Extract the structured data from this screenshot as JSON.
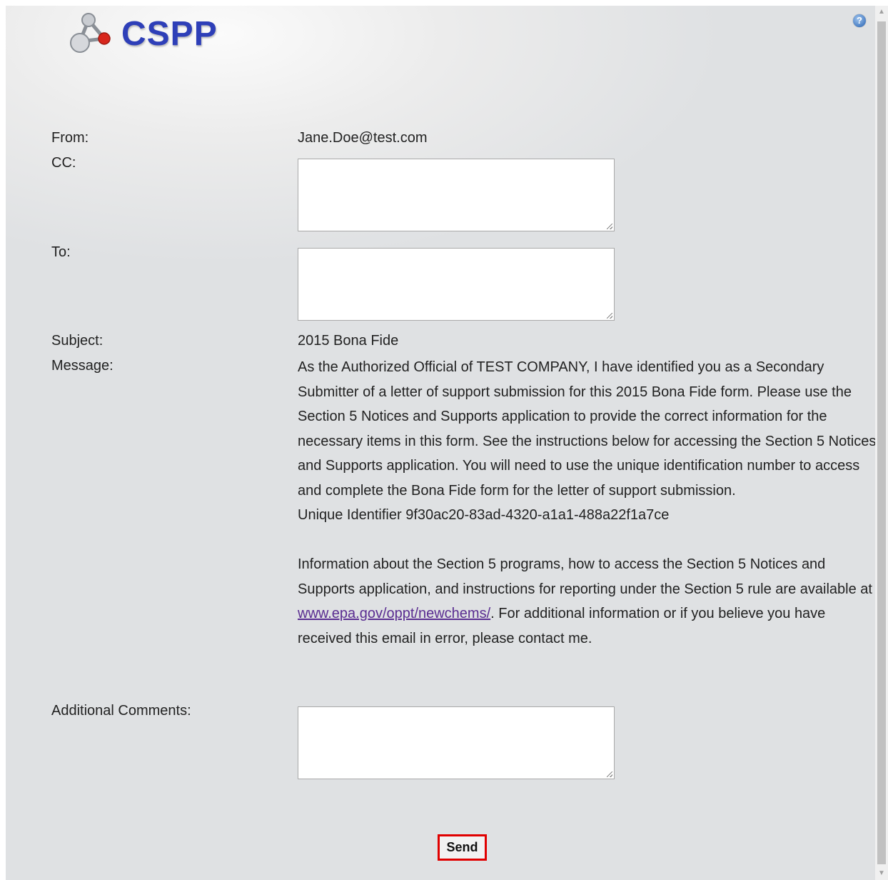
{
  "header": {
    "logo_text": "CSPP",
    "help_icon": "?"
  },
  "form": {
    "from_label": "From:",
    "from_value": "Jane.Doe@test.com",
    "cc_label": "CC:",
    "cc_value": "",
    "to_label": "To:",
    "to_value": "",
    "subject_label": "Subject:",
    "subject_value": "2015 Bona Fide",
    "message_label": "Message:",
    "message_para1": "As the Authorized Official of TEST COMPANY, I have identified you as a Secondary Submitter of a letter of support submission for this 2015 Bona Fide form. Please use the Section 5 Notices and Supports application to provide the correct information for the necessary items in this form. See the instructions below for accessing the Section 5 Notices and Supports application. You will need to use the unique identification number to access and complete the Bona Fide form for the letter of support submission.",
    "message_identifier": "Unique Identifier 9f30ac20-83ad-4320-a1a1-488a22f1a7ce",
    "message_para2_before": "Information about the Section 5 programs, how to access the Section 5 Notices and Supports application, and instructions for reporting under the Section 5 rule are available at ",
    "message_link": "www.epa.gov/oppt/newchems/",
    "message_para2_after": ". For additional information or if you believe you have received this email in error, please contact me.",
    "comments_label": "Additional Comments:",
    "comments_value": ""
  },
  "actions": {
    "send_label": "Send"
  },
  "colors": {
    "logo": "#2e3fb8",
    "send_border": "#e00000",
    "link": "#5a2d91"
  }
}
